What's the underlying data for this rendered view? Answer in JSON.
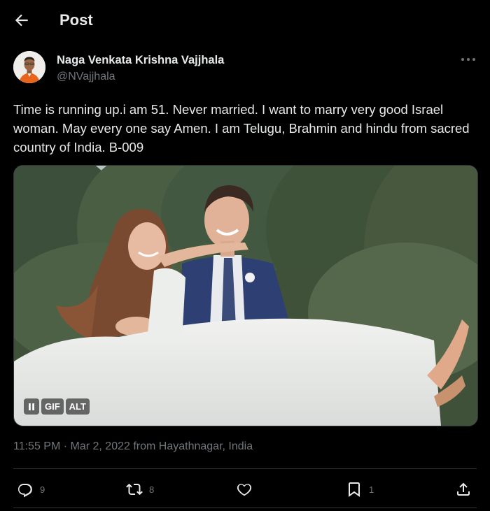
{
  "header": {
    "title": "Post"
  },
  "author": {
    "name": "Naga Venkata Krishna Vajjhala",
    "handle": "@NVajjhala"
  },
  "post": {
    "text": "Time is running up.i am 51. Never married.  I want to marry very good Israel woman.  May every one say Amen. I am Telugu, Brahmin and hindu from sacred country of India.  B-009",
    "timestamp": "11:55 PM · Mar 2, 2022 from Hayathnagar, India"
  },
  "media": {
    "type": "gif",
    "badges": {
      "gif": "GIF",
      "alt": "ALT"
    }
  },
  "actions": {
    "replies": "9",
    "reposts": "8",
    "likes": "",
    "bookmarks": "1"
  },
  "colors": {
    "background": "#000000",
    "text_primary": "#e7e9ea",
    "text_secondary": "#71767b",
    "divider": "#2f3336"
  },
  "icons": [
    "back-arrow-icon",
    "more-icon",
    "reply-icon",
    "repost-icon",
    "like-icon",
    "bookmark-icon",
    "share-icon",
    "pause-icon"
  ]
}
